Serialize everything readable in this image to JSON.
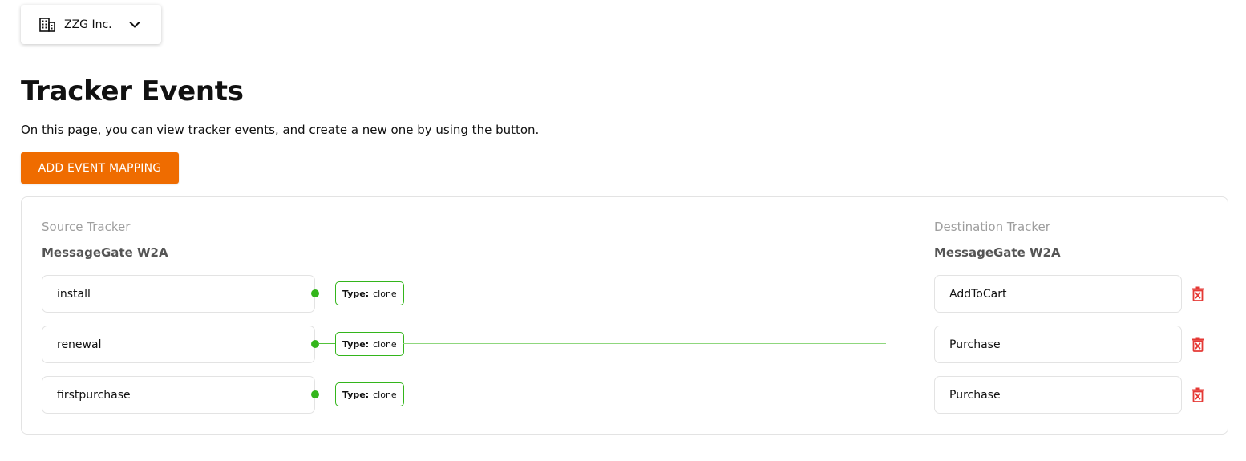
{
  "org_switcher": {
    "name": "ZZG Inc.",
    "icon": "building-icon",
    "chevron": "chevron-down-icon"
  },
  "page": {
    "title": "Tracker Events",
    "description": "On this page, you can view tracker events, and create a new one by using the button.",
    "add_button_label": "ADD EVENT MAPPING"
  },
  "colors": {
    "accent": "#ef6c00",
    "link_green": "#33b51b",
    "delete_red": "#e53935"
  },
  "source": {
    "label": "Source Tracker",
    "tracker_name": "MessageGate W2A"
  },
  "destination": {
    "label": "Destination Tracker",
    "tracker_name": "MessageGate W2A"
  },
  "type_key": "Type:",
  "mappings": [
    {
      "source_event": "install",
      "type": "clone",
      "destination_event": "AddToCart"
    },
    {
      "source_event": "renewal",
      "type": "clone",
      "destination_event": "Purchase"
    },
    {
      "source_event": "firstpurchase",
      "type": "clone",
      "destination_event": "Purchase"
    }
  ]
}
